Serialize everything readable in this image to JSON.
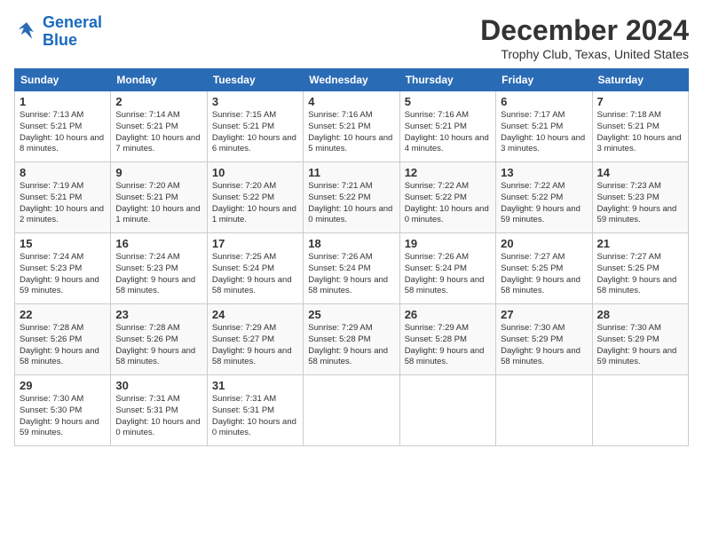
{
  "header": {
    "logo_line1": "General",
    "logo_line2": "Blue",
    "month_title": "December 2024",
    "location": "Trophy Club, Texas, United States"
  },
  "days_of_week": [
    "Sunday",
    "Monday",
    "Tuesday",
    "Wednesday",
    "Thursday",
    "Friday",
    "Saturday"
  ],
  "weeks": [
    [
      {
        "day": "1",
        "sunrise": "7:13 AM",
        "sunset": "5:21 PM",
        "daylight": "10 hours and 8 minutes."
      },
      {
        "day": "2",
        "sunrise": "7:14 AM",
        "sunset": "5:21 PM",
        "daylight": "10 hours and 7 minutes."
      },
      {
        "day": "3",
        "sunrise": "7:15 AM",
        "sunset": "5:21 PM",
        "daylight": "10 hours and 6 minutes."
      },
      {
        "day": "4",
        "sunrise": "7:16 AM",
        "sunset": "5:21 PM",
        "daylight": "10 hours and 5 minutes."
      },
      {
        "day": "5",
        "sunrise": "7:16 AM",
        "sunset": "5:21 PM",
        "daylight": "10 hours and 4 minutes."
      },
      {
        "day": "6",
        "sunrise": "7:17 AM",
        "sunset": "5:21 PM",
        "daylight": "10 hours and 3 minutes."
      },
      {
        "day": "7",
        "sunrise": "7:18 AM",
        "sunset": "5:21 PM",
        "daylight": "10 hours and 3 minutes."
      }
    ],
    [
      {
        "day": "8",
        "sunrise": "7:19 AM",
        "sunset": "5:21 PM",
        "daylight": "10 hours and 2 minutes."
      },
      {
        "day": "9",
        "sunrise": "7:20 AM",
        "sunset": "5:21 PM",
        "daylight": "10 hours and 1 minute."
      },
      {
        "day": "10",
        "sunrise": "7:20 AM",
        "sunset": "5:22 PM",
        "daylight": "10 hours and 1 minute."
      },
      {
        "day": "11",
        "sunrise": "7:21 AM",
        "sunset": "5:22 PM",
        "daylight": "10 hours and 0 minutes."
      },
      {
        "day": "12",
        "sunrise": "7:22 AM",
        "sunset": "5:22 PM",
        "daylight": "10 hours and 0 minutes."
      },
      {
        "day": "13",
        "sunrise": "7:22 AM",
        "sunset": "5:22 PM",
        "daylight": "9 hours and 59 minutes."
      },
      {
        "day": "14",
        "sunrise": "7:23 AM",
        "sunset": "5:23 PM",
        "daylight": "9 hours and 59 minutes."
      }
    ],
    [
      {
        "day": "15",
        "sunrise": "7:24 AM",
        "sunset": "5:23 PM",
        "daylight": "9 hours and 59 minutes."
      },
      {
        "day": "16",
        "sunrise": "7:24 AM",
        "sunset": "5:23 PM",
        "daylight": "9 hours and 58 minutes."
      },
      {
        "day": "17",
        "sunrise": "7:25 AM",
        "sunset": "5:24 PM",
        "daylight": "9 hours and 58 minutes."
      },
      {
        "day": "18",
        "sunrise": "7:26 AM",
        "sunset": "5:24 PM",
        "daylight": "9 hours and 58 minutes."
      },
      {
        "day": "19",
        "sunrise": "7:26 AM",
        "sunset": "5:24 PM",
        "daylight": "9 hours and 58 minutes."
      },
      {
        "day": "20",
        "sunrise": "7:27 AM",
        "sunset": "5:25 PM",
        "daylight": "9 hours and 58 minutes."
      },
      {
        "day": "21",
        "sunrise": "7:27 AM",
        "sunset": "5:25 PM",
        "daylight": "9 hours and 58 minutes."
      }
    ],
    [
      {
        "day": "22",
        "sunrise": "7:28 AM",
        "sunset": "5:26 PM",
        "daylight": "9 hours and 58 minutes."
      },
      {
        "day": "23",
        "sunrise": "7:28 AM",
        "sunset": "5:26 PM",
        "daylight": "9 hours and 58 minutes."
      },
      {
        "day": "24",
        "sunrise": "7:29 AM",
        "sunset": "5:27 PM",
        "daylight": "9 hours and 58 minutes."
      },
      {
        "day": "25",
        "sunrise": "7:29 AM",
        "sunset": "5:28 PM",
        "daylight": "9 hours and 58 minutes."
      },
      {
        "day": "26",
        "sunrise": "7:29 AM",
        "sunset": "5:28 PM",
        "daylight": "9 hours and 58 minutes."
      },
      {
        "day": "27",
        "sunrise": "7:30 AM",
        "sunset": "5:29 PM",
        "daylight": "9 hours and 58 minutes."
      },
      {
        "day": "28",
        "sunrise": "7:30 AM",
        "sunset": "5:29 PM",
        "daylight": "9 hours and 59 minutes."
      }
    ],
    [
      {
        "day": "29",
        "sunrise": "7:30 AM",
        "sunset": "5:30 PM",
        "daylight": "9 hours and 59 minutes."
      },
      {
        "day": "30",
        "sunrise": "7:31 AM",
        "sunset": "5:31 PM",
        "daylight": "10 hours and 0 minutes."
      },
      {
        "day": "31",
        "sunrise": "7:31 AM",
        "sunset": "5:31 PM",
        "daylight": "10 hours and 0 minutes."
      },
      null,
      null,
      null,
      null
    ]
  ],
  "labels": {
    "sunrise": "Sunrise:",
    "sunset": "Sunset:",
    "daylight": "Daylight:"
  }
}
